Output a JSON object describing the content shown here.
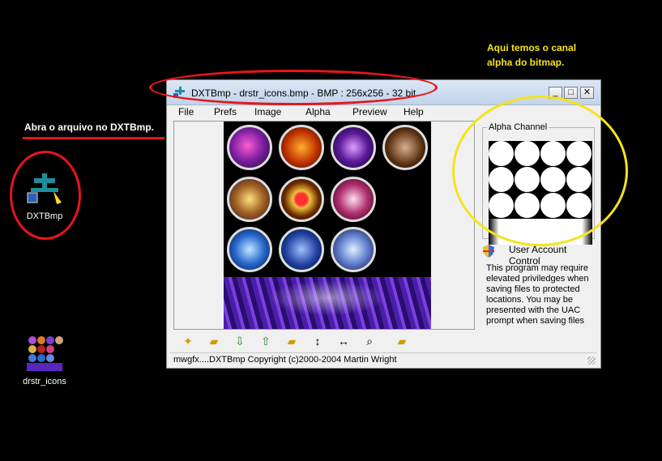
{
  "desktop": {
    "icons": [
      {
        "label": "DXTBmp",
        "icon": "dxtbmp-app-icon"
      },
      {
        "label": "drstr_icons",
        "icon": "image-thumbnail-icon"
      }
    ]
  },
  "annotations": {
    "left_note": "Abra o arquivo no DXTBmp.",
    "right_note_line1": "Aqui temos o canal",
    "right_note_line2": "alpha do bitmap.",
    "colors": {
      "red": "#e8141b",
      "yellow": "#f6e21d"
    }
  },
  "window": {
    "title": "DXTBmp - drstr_icons.bmp - BMP : 256x256 - 32 bit",
    "controls": {
      "minimize": "_",
      "maximize": "□",
      "close": "✕"
    },
    "menu": [
      "File",
      "Prefs",
      "Image",
      "Alpha",
      "Preview",
      "Help"
    ],
    "alpha_group_title": "Alpha Channel",
    "uac_heading": "User Account Control",
    "uac_text": "This program may require elevated priviledges when saving files to protected locations. You may be presented with the UAC prompt when saving files",
    "toolbar_icons": [
      "star-icon",
      "open-folder-icon",
      "import-icon",
      "export-icon",
      "open-alpha-icon",
      "flip-vertical-icon",
      "flip-horizontal-icon",
      "zoom-icon",
      "open-folder-alt-icon"
    ],
    "status": "mwgfx....DXTBmp Copyright (c)2000-2004 Martin Wright"
  }
}
